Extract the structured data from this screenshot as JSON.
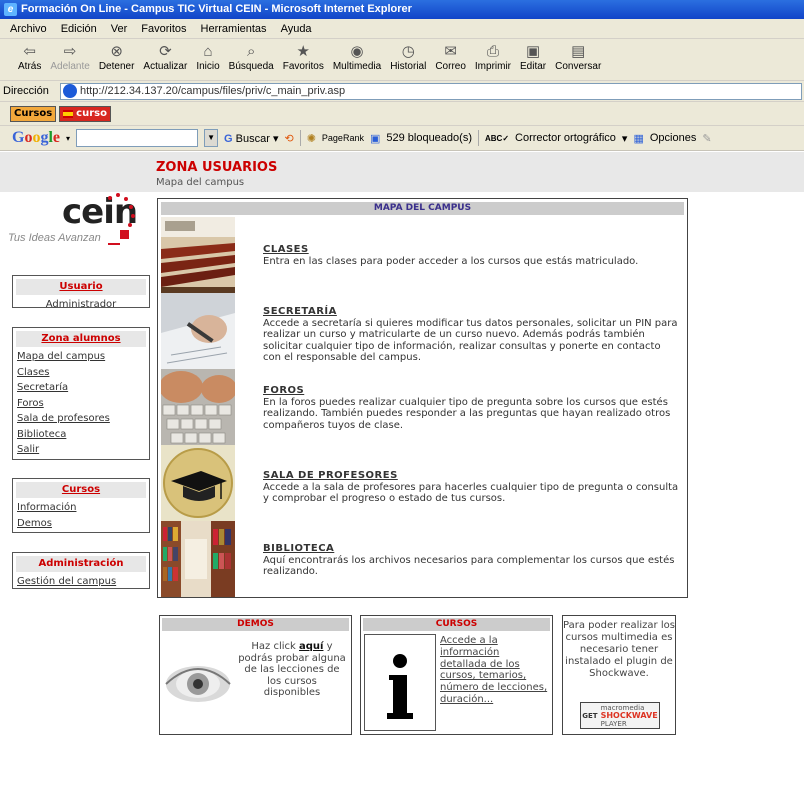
{
  "window": {
    "title": "Formación On Line - Campus TIC Virtual CEIN - Microsoft Internet Explorer"
  },
  "menu": [
    "Archivo",
    "Edición",
    "Ver",
    "Favoritos",
    "Herramientas",
    "Ayuda"
  ],
  "toolbar": [
    {
      "label": "Atrás",
      "icon": "back-arrow-icon",
      "glyph": "⇦",
      "disabled": false
    },
    {
      "label": "Adelante",
      "icon": "forward-arrow-icon",
      "glyph": "⇨",
      "disabled": true
    },
    {
      "label": "Detener",
      "icon": "stop-icon",
      "glyph": "⊗",
      "disabled": false
    },
    {
      "label": "Actualizar",
      "icon": "refresh-icon",
      "glyph": "⟳",
      "disabled": false
    },
    {
      "label": "Inicio",
      "icon": "home-icon",
      "glyph": "⌂",
      "disabled": false
    },
    {
      "label": "Búsqueda",
      "icon": "search-icon",
      "glyph": "⌕",
      "disabled": false
    },
    {
      "label": "Favoritos",
      "icon": "favorites-icon",
      "glyph": "★",
      "disabled": false
    },
    {
      "label": "Multimedia",
      "icon": "media-icon",
      "glyph": "◉",
      "disabled": false
    },
    {
      "label": "Historial",
      "icon": "history-icon",
      "glyph": "◷",
      "disabled": false
    },
    {
      "label": "Correo",
      "icon": "mail-icon",
      "glyph": "✉",
      "disabled": false
    },
    {
      "label": "Imprimir",
      "icon": "print-icon",
      "glyph": "⎙",
      "disabled": false
    },
    {
      "label": "Editar",
      "icon": "edit-icon",
      "glyph": "▣",
      "disabled": false
    },
    {
      "label": "Conversar",
      "icon": "discuss-icon",
      "glyph": "▤",
      "disabled": false
    }
  ],
  "address": {
    "label": "Dirección",
    "url": "http://212.34.137.20/campus/files/priv/c_main_priv.asp"
  },
  "links": {
    "cursos1": "Cursos",
    "cursos2": "curso"
  },
  "google": {
    "logo": "Google",
    "buscar": "Buscar",
    "pagerank": "PageRank",
    "blocked": "529 bloqueado(s)",
    "spell": "Corrector ortográfico",
    "options": "Opciones"
  },
  "logo": {
    "word": "cein",
    "tagline": "Tus Ideas Avanzan"
  },
  "sidebar": {
    "usuario": {
      "title": "Usuario",
      "value": "Administrador"
    },
    "zona": {
      "title": "Zona alumnos",
      "items": [
        "Mapa del campus",
        "Clases",
        "Secretaría",
        "Foros",
        "Sala de profesores",
        "Biblioteca",
        "Salir"
      ]
    },
    "cursos": {
      "title": "Cursos",
      "items": [
        "Información",
        "Demos"
      ]
    },
    "admin": {
      "title": "Administración",
      "items": [
        "Gestión del campus"
      ]
    }
  },
  "main": {
    "title": "ZONA USUARIOS",
    "subtitle": "Mapa del campus",
    "map_header": "MAPA DEL CAMPUS",
    "rows": [
      {
        "title": "CLASES",
        "text": "Entra en las clases para poder acceder a los cursos que estás matriculado."
      },
      {
        "title": "SECRETARÍA",
        "text": "Accede a secretaría si quieres modificar tus datos personales, solicitar un PIN para realizar un curso y matricularte de un curso nuevo. Además podrás también solicitar cualquier tipo de información, realizar consultas y ponerte en contacto con el responsable del campus."
      },
      {
        "title": "FOROS",
        "text": "En la foros puedes realizar cualquier tipo de pregunta sobre los cursos que estés realizando. También puedes responder a las preguntas que hayan realizado otros compañeros tuyos de clase."
      },
      {
        "title": "SALA DE PROFESORES",
        "text": "Accede a la sala de profesores para hacerles cualquier tipo de pregunta o consulta y comprobar el progreso o estado de tus cursos."
      },
      {
        "title": "BIBLIOTECA",
        "text": "Aquí encontrarás los archivos necesarios para complementar los cursos que estés realizando."
      }
    ]
  },
  "demos": {
    "header": "DEMOS",
    "pre": "Haz click ",
    "link": "aquí",
    "post": " y podrás probar alguna de las lecciones de los cursos disponibles"
  },
  "cursos_box": {
    "header": "CURSOS",
    "link": "Accede a la información detallada de los cursos, temarios, número de lecciones, duración..."
  },
  "shockwave": {
    "text": "Para poder realizar los cursos multimedia es necesario tener instalado el plugin de Shockwave.",
    "get": "GET",
    "macromedia": "macromedia",
    "shockwave": "SHOCKWAVE",
    "player": "PLAYER"
  }
}
